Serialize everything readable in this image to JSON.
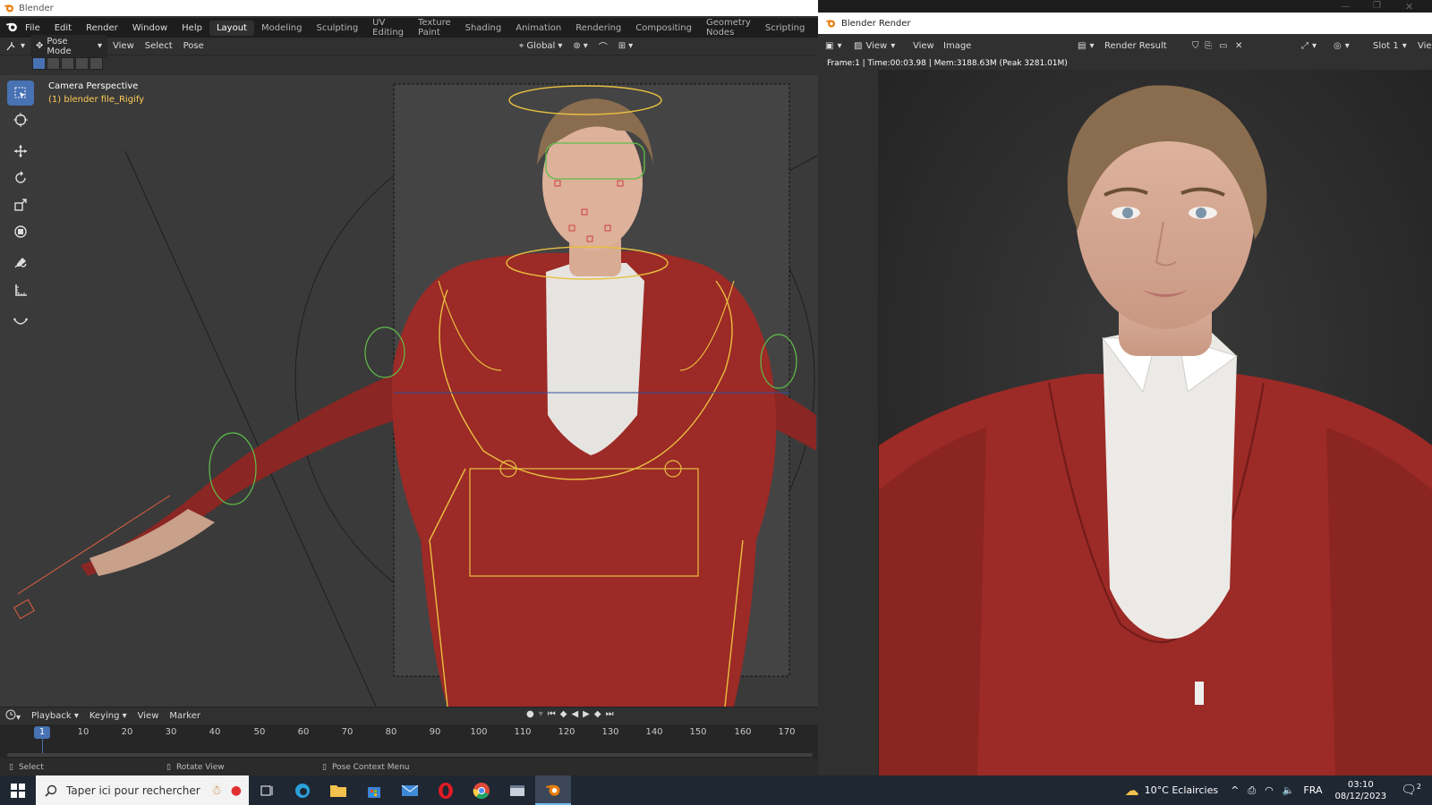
{
  "app": {
    "window_title": "Blender",
    "menus": [
      "File",
      "Edit",
      "Render",
      "Window",
      "Help"
    ],
    "workspaces": [
      "Layout",
      "Modeling",
      "Sculpting",
      "UV Editing",
      "Texture Paint",
      "Shading",
      "Animation",
      "Rendering",
      "Compositing",
      "Geometry Nodes",
      "Scripting"
    ],
    "active_workspace": "Layout",
    "add_workspace": "+"
  },
  "viewport_header": {
    "mode": "Pose Mode",
    "menus": [
      "View",
      "Select",
      "Pose"
    ],
    "transform_orientation": "Global"
  },
  "viewport": {
    "view_label": "Camera Perspective",
    "object_label": "(1) blender file_Rigify",
    "tools": [
      "select-box-icon",
      "cursor-icon",
      "move-icon",
      "rotate-icon",
      "scale-icon",
      "transform-icon",
      "annotate-icon",
      "measure-icon",
      "relax-pose-icon"
    ]
  },
  "timeline": {
    "menus": [
      "Playback",
      "Keying",
      "View",
      "Marker"
    ],
    "current_frame": "1",
    "ticks": [
      "10",
      "20",
      "30",
      "40",
      "50",
      "60",
      "70",
      "80",
      "90",
      "100",
      "110",
      "120",
      "130",
      "140",
      "150",
      "160",
      "170"
    ]
  },
  "statusbar": {
    "select": "Select",
    "rotate": "Rotate View",
    "context": "Pose Context Menu"
  },
  "render_window": {
    "title": "Blender Render",
    "menus": [
      "View",
      "View",
      "Image"
    ],
    "image_name": "Render Result",
    "slot": "Slot 1",
    "view_trunc": "Vie",
    "info": "Frame:1 | Time:00:03.98 | Mem:3188.63M (Peak 3281.01M)"
  },
  "taskbar": {
    "search_placeholder": "Taper ici pour rechercher",
    "weather": "10°C  Eclaircies",
    "language": "FRA",
    "time": "03:10",
    "date": "08/12/2023",
    "notifications": "2"
  },
  "colors": {
    "accent": "#4772b3",
    "jacket": "#9c2a26",
    "rig_yellow": "#e8c040",
    "rig_green": "#5fbf4a"
  }
}
